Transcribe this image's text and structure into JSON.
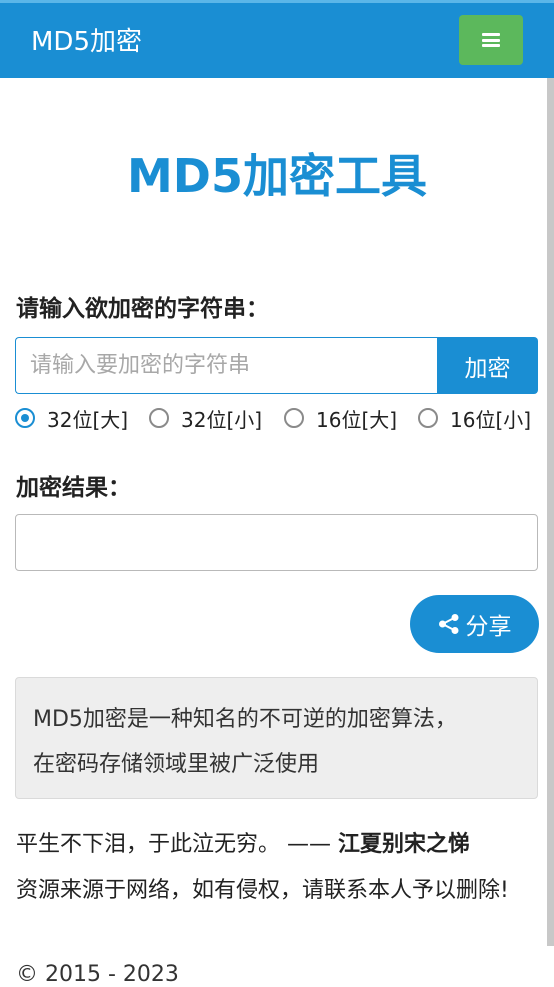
{
  "header": {
    "brand": "MD5加密",
    "menu_icon": "hamburger-icon",
    "colors": {
      "bar": "#1a8ed3",
      "menu_button": "#5cb85c"
    }
  },
  "main": {
    "title": "MD5加密工具",
    "input_label": "请输入欲加密的字符串：",
    "input_value": "",
    "input_placeholder": "请输入要加密的字符串",
    "encrypt_label": "加密",
    "options": [
      {
        "label": "32位[大]",
        "selected": true
      },
      {
        "label": "32位[小]",
        "selected": false
      },
      {
        "label": "16位[大]",
        "selected": false
      },
      {
        "label": "16位[小]",
        "selected": false
      }
    ],
    "result_label": "加密结果：",
    "result_value": "",
    "share_label": "分享",
    "share_icon": "share-icon",
    "info_line1": "MD5加密是一种知名的不可逆的加密算法，",
    "info_line2": "在密码存储领域里被广泛使用"
  },
  "footer": {
    "quote": "平生不下泪，于此泣无穷。 ——",
    "quote_source": "江夏别宋之悌",
    "disclaimer": "资源来源于网络，如有侵权，请联系本人予以删除!",
    "copyright": "© 2015 - 2023"
  }
}
